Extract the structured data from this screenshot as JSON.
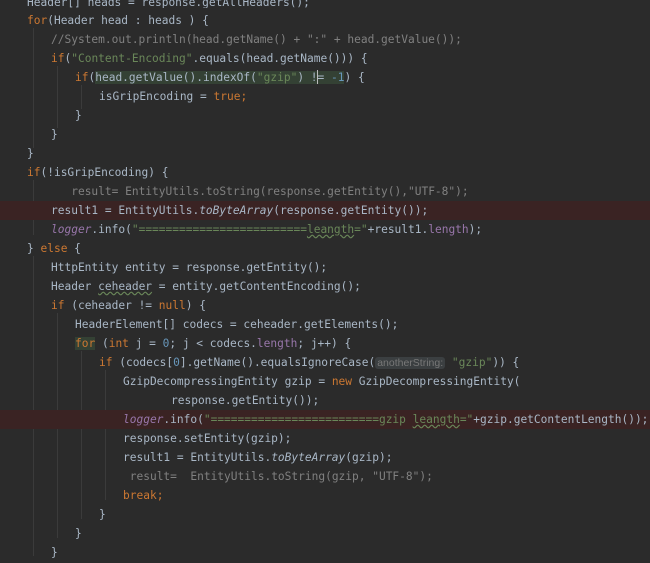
{
  "editor": {
    "lines": [
      {
        "indent": 0,
        "clip": true,
        "tokens": [
          {
            "t": "Header[] heads = response.getAllHeaders();",
            "c": "plain"
          }
        ]
      },
      {
        "indent": 0,
        "tokens": [
          {
            "t": "for",
            "c": "kw"
          },
          {
            "t": "(Header head : heads ) {",
            "c": "plain"
          }
        ]
      },
      {
        "indent": 1,
        "tokens": [
          {
            "t": "//System.out.println(head.getName() + \":\" + head.getValue());",
            "c": "cm"
          }
        ]
      },
      {
        "indent": 1,
        "tokens": [
          {
            "t": "if",
            "c": "kw"
          },
          {
            "t": "(",
            "c": "plain"
          },
          {
            "t": "\"Content-Encoding\"",
            "c": "str"
          },
          {
            "t": ".equals(head.getName())) {",
            "c": "plain"
          }
        ]
      },
      {
        "indent": 2,
        "tokens": [
          {
            "t": "if",
            "c": "kw"
          },
          {
            "t": "(",
            "c": "plain"
          },
          {
            "t": "head.getValue().indexOf(",
            "c": "plain hl"
          },
          {
            "t": "\"gzip\"",
            "c": "str hl"
          },
          {
            "t": ") != ",
            "c": "plain hl"
          },
          {
            "t": "-1",
            "c": "num hl"
          },
          {
            "t": ") {",
            "c": "plain"
          }
        ]
      },
      {
        "indent": 3,
        "tokens": [
          {
            "t": "isGripEncoding = ",
            "c": "plain"
          },
          {
            "t": "true",
            "c": "kw"
          },
          {
            "t": ";",
            "c": "kw"
          }
        ]
      },
      {
        "indent": 2,
        "tokens": [
          {
            "t": "}",
            "c": "plain"
          }
        ]
      },
      {
        "indent": 1,
        "tokens": [
          {
            "t": "}",
            "c": "plain"
          }
        ]
      },
      {
        "indent": 0,
        "tokens": [
          {
            "t": "}",
            "c": "plain"
          }
        ]
      },
      {
        "indent": 0,
        "tokens": [
          {
            "t": "if",
            "c": "kw"
          },
          {
            "t": "(!isGripEncoding) {",
            "c": "plain"
          }
        ]
      },
      {
        "indent": 1,
        "extra": "   ",
        "tokens": [
          {
            "t": "result= EntityUtils.toString(response.getEntity(),\"UTF-8\");",
            "c": "cm"
          }
        ]
      },
      {
        "indent": 1,
        "err": true,
        "tokens": [
          {
            "t": "result1 = EntityUtils.",
            "c": "plain"
          },
          {
            "t": "toByteArray",
            "c": "plain stat"
          },
          {
            "t": "(response.getEntity());",
            "c": "plain"
          }
        ]
      },
      {
        "indent": 1,
        "tokens": [
          {
            "t": "logger",
            "c": "log"
          },
          {
            "t": ".info(",
            "c": "plain"
          },
          {
            "t": "\"=========================",
            "c": "str"
          },
          {
            "t": "leangth",
            "c": "str squig"
          },
          {
            "t": "=\"",
            "c": "str"
          },
          {
            "t": "+result1.",
            "c": "plain"
          },
          {
            "t": "length",
            "c": "fld"
          },
          {
            "t": ");",
            "c": "plain"
          }
        ]
      },
      {
        "indent": 0,
        "tokens": [
          {
            "t": "} ",
            "c": "plain"
          },
          {
            "t": "else",
            "c": "kw"
          },
          {
            "t": " {",
            "c": "plain"
          }
        ]
      },
      {
        "indent": 1,
        "tokens": [
          {
            "t": "HttpEntity entity = response.getEntity();",
            "c": "plain"
          }
        ]
      },
      {
        "indent": 1,
        "tokens": [
          {
            "t": "Header ",
            "c": "plain"
          },
          {
            "t": "ceheader",
            "c": "plain squig"
          },
          {
            "t": " = entity.getContentEncoding();",
            "c": "plain"
          }
        ]
      },
      {
        "indent": 1,
        "tokens": [
          {
            "t": "if",
            "c": "kw"
          },
          {
            "t": " (ceheader != ",
            "c": "plain"
          },
          {
            "t": "null",
            "c": "kw"
          },
          {
            "t": ") {",
            "c": "plain"
          }
        ]
      },
      {
        "indent": 2,
        "tokens": [
          {
            "t": "HeaderElement[] codecs = ceheader.getElements();",
            "c": "plain"
          }
        ]
      },
      {
        "indent": 2,
        "tokens": [
          {
            "t": "for",
            "c": "kw hl"
          },
          {
            "t": " (",
            "c": "plain"
          },
          {
            "t": "int",
            "c": "kw"
          },
          {
            "t": " j = ",
            "c": "plain"
          },
          {
            "t": "0",
            "c": "num"
          },
          {
            "t": "; j < codecs.",
            "c": "plain"
          },
          {
            "t": "length",
            "c": "fld"
          },
          {
            "t": "; j++) {",
            "c": "plain"
          }
        ]
      },
      {
        "indent": 3,
        "tokens": [
          {
            "t": "if",
            "c": "kw"
          },
          {
            "t": " (codecs[",
            "c": "plain"
          },
          {
            "t": "0",
            "c": "num"
          },
          {
            "t": "].getName().equalsIgnoreCase(",
            "c": "plain"
          },
          {
            "t": "anotherString:",
            "c": "hint"
          },
          {
            "t": " ",
            "c": "plain"
          },
          {
            "t": "\"gzip\"",
            "c": "str"
          },
          {
            "t": ")) {",
            "c": "plain"
          }
        ]
      },
      {
        "indent": 4,
        "tokens": [
          {
            "t": "GzipDecompressingEntity gzip = ",
            "c": "plain"
          },
          {
            "t": "new",
            "c": "kw"
          },
          {
            "t": " GzipDecompressingEntity(",
            "c": "plain"
          }
        ]
      },
      {
        "indent": 6,
        "tokens": [
          {
            "t": "response.getEntity());",
            "c": "plain"
          }
        ]
      },
      {
        "indent": 4,
        "err": true,
        "tokens": [
          {
            "t": "logger",
            "c": "log"
          },
          {
            "t": ".info(",
            "c": "plain"
          },
          {
            "t": "\"=========================gzip ",
            "c": "str"
          },
          {
            "t": "leangth",
            "c": "str squig"
          },
          {
            "t": "=\"",
            "c": "str"
          },
          {
            "t": "+gzip.getContentLength());",
            "c": "plain"
          }
        ]
      },
      {
        "indent": 4,
        "tokens": [
          {
            "t": "response.setEntity(gzip);",
            "c": "plain"
          }
        ]
      },
      {
        "indent": 4,
        "tokens": [
          {
            "t": "result1 = EntityUtils.",
            "c": "plain"
          },
          {
            "t": "toByteArray",
            "c": "plain stat"
          },
          {
            "t": "(gzip);",
            "c": "plain"
          }
        ]
      },
      {
        "indent": 4,
        "extra": " ",
        "tokens": [
          {
            "t": "result=  EntityUtils.toString(gzip, \"UTF-8\");",
            "c": "cm"
          }
        ]
      },
      {
        "indent": 4,
        "tokens": [
          {
            "t": "break",
            "c": "kw"
          },
          {
            "t": ";",
            "c": "kw"
          }
        ]
      },
      {
        "indent": 3,
        "tokens": [
          {
            "t": "}",
            "c": "plain"
          }
        ]
      },
      {
        "indent": 2,
        "tokens": [
          {
            "t": "}",
            "c": "plain"
          }
        ]
      },
      {
        "indent": 1,
        "tokens": [
          {
            "t": "}",
            "c": "plain"
          }
        ]
      }
    ]
  }
}
